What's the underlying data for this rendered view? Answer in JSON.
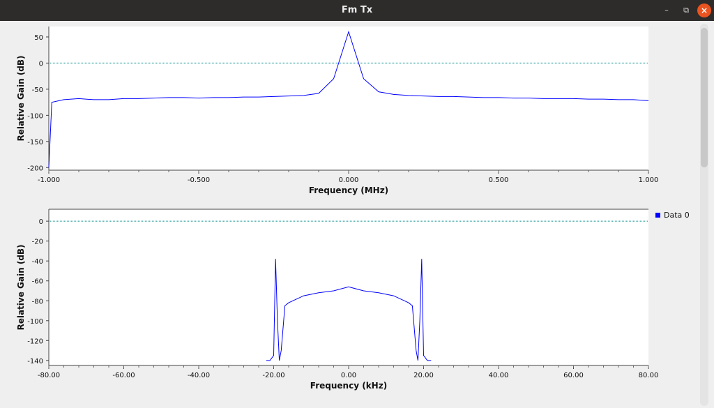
{
  "window": {
    "title": "Fm Tx",
    "minimize_glyph": "–",
    "maximize_glyph": "⧉",
    "close_glyph": "×"
  },
  "plot1": {
    "ylabel": "Relative Gain (dB)",
    "xlabel": "Frequency (MHz)",
    "yticks": [
      "50",
      "0",
      "-50",
      "-100",
      "-150",
      "-200"
    ],
    "xticks": [
      "-1.000",
      "-0.500",
      "0.000",
      "0.500",
      "1.000"
    ]
  },
  "plot2": {
    "ylabel": "Relative Gain (dB)",
    "xlabel": "Frequency (kHz)",
    "yticks": [
      "0",
      "-20",
      "-40",
      "-60",
      "-80",
      "-100",
      "-120",
      "-140"
    ],
    "xticks": [
      "-80.00",
      "-60.00",
      "-40.00",
      "-20.00",
      "0.00",
      "20.00",
      "40.00",
      "60.00",
      "80.00"
    ],
    "legend": "Data 0"
  },
  "colors": {
    "trace": "#0000ff",
    "reference": "#008b8b",
    "plot_bg": "#ffffff"
  },
  "chart_data": [
    {
      "type": "line",
      "xlabel": "Frequency (MHz)",
      "ylabel": "Relative Gain (dB)",
      "xlim": [
        -1.0,
        1.0
      ],
      "ylim": [
        -205,
        70
      ],
      "reference_line": 0,
      "series": [
        {
          "x": [
            -1.0,
            -0.99,
            -0.95,
            -0.9,
            -0.85,
            -0.8,
            -0.75,
            -0.7,
            -0.65,
            -0.6,
            -0.55,
            -0.5,
            -0.45,
            -0.4,
            -0.35,
            -0.3,
            -0.25,
            -0.2,
            -0.15,
            -0.1,
            -0.05,
            0.0,
            0.05,
            0.1,
            0.15,
            0.2,
            0.25,
            0.3,
            0.35,
            0.4,
            0.45,
            0.5,
            0.55,
            0.6,
            0.65,
            0.7,
            0.75,
            0.8,
            0.85,
            0.9,
            0.95,
            1.0
          ],
          "y": [
            -200,
            -75,
            -70,
            -68,
            -70,
            -70,
            -68,
            -68,
            -67,
            -66,
            -66,
            -67,
            -66,
            -66,
            -65,
            -65,
            -64,
            -63,
            -62,
            -58,
            -30,
            60,
            -30,
            -55,
            -60,
            -62,
            -63,
            -64,
            -64,
            -65,
            -66,
            -66,
            -67,
            -67,
            -68,
            -68,
            -68,
            -69,
            -69,
            -70,
            -70,
            -72
          ]
        }
      ]
    },
    {
      "type": "line",
      "xlabel": "Frequency (kHz)",
      "ylabel": "Relative Gain (dB)",
      "xlim": [
        -80,
        80
      ],
      "ylim": [
        -145,
        12
      ],
      "reference_line": 0,
      "series": [
        {
          "name": "Data 0",
          "x": [
            -22,
            -21,
            -20,
            -19.5,
            -19,
            -18.5,
            -18,
            -17,
            -16,
            -12,
            -8,
            -4,
            0,
            4,
            8,
            12,
            16,
            17,
            18,
            18.5,
            19,
            19.5,
            20,
            21,
            22
          ],
          "y": [
            -140,
            -140,
            -135,
            -38,
            -100,
            -140,
            -130,
            -85,
            -82,
            -75,
            -72,
            -70,
            -66,
            -70,
            -72,
            -75,
            -82,
            -85,
            -130,
            -140,
            -100,
            -38,
            -135,
            -140,
            -140
          ]
        }
      ]
    }
  ]
}
